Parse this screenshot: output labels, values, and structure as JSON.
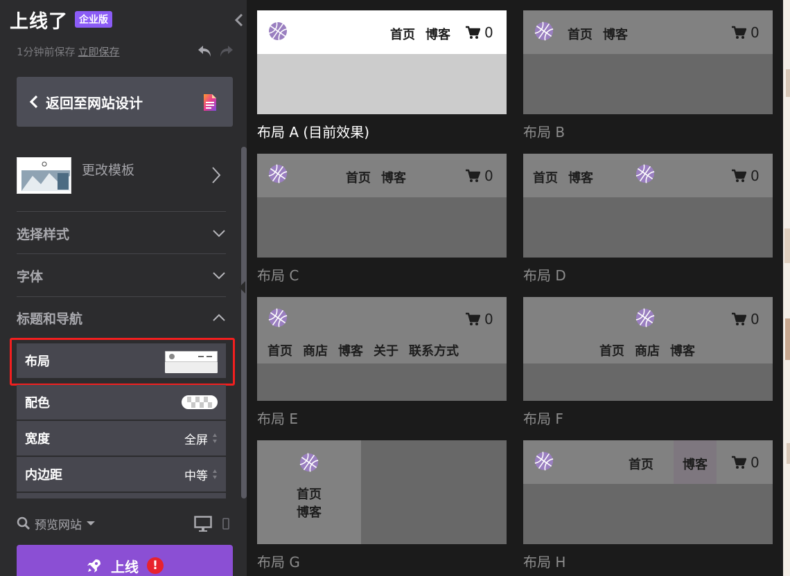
{
  "app": {
    "logo_text": "上线了",
    "edition_badge": "企业版"
  },
  "save": {
    "status": "1分钟前保存",
    "save_now": "立即保存"
  },
  "back_button": {
    "label": "返回至网站设计"
  },
  "template": {
    "label": "更改模板"
  },
  "sections": {
    "style": "选择样式",
    "font": "字体",
    "header_nav": "标题和导航"
  },
  "properties": {
    "layout_label": "布局",
    "color_label": "配色",
    "width_label": "宽度",
    "width_value": "全屏",
    "padding_label": "内边距",
    "padding_value": "中等"
  },
  "footer": {
    "preview_label": "预览网站",
    "publish_label": "上线",
    "publish_alert": "!"
  },
  "colors": {
    "accent": "#8b5cf6",
    "publish": "#8b4fd4",
    "highlight": "#f21f1f",
    "logo_purple": "#9a7fc0"
  },
  "layouts": [
    {
      "caption": "布局 A (目前效果)",
      "nav": [
        "首页",
        "博客"
      ],
      "cart": "0",
      "active": true
    },
    {
      "caption": "布局 B",
      "nav": [
        "首页",
        "博客"
      ],
      "cart": "0"
    },
    {
      "caption": "布局 C",
      "nav": [
        "首页",
        "博客"
      ],
      "cart": "0"
    },
    {
      "caption": "布局 D",
      "nav": [
        "首页",
        "博客"
      ],
      "cart": "0"
    },
    {
      "caption": "布局 E",
      "nav": [
        "首页",
        "商店",
        "博客",
        "关于",
        "联系方式"
      ],
      "cart": "0"
    },
    {
      "caption": "布局 F",
      "nav": [
        "首页",
        "商店",
        "博客"
      ],
      "cart": "0"
    },
    {
      "caption": "布局 G",
      "nav": [
        "首页",
        "博客"
      ]
    },
    {
      "caption": "布局 H",
      "nav": [
        "首页",
        "博客"
      ],
      "cart": "0"
    }
  ]
}
